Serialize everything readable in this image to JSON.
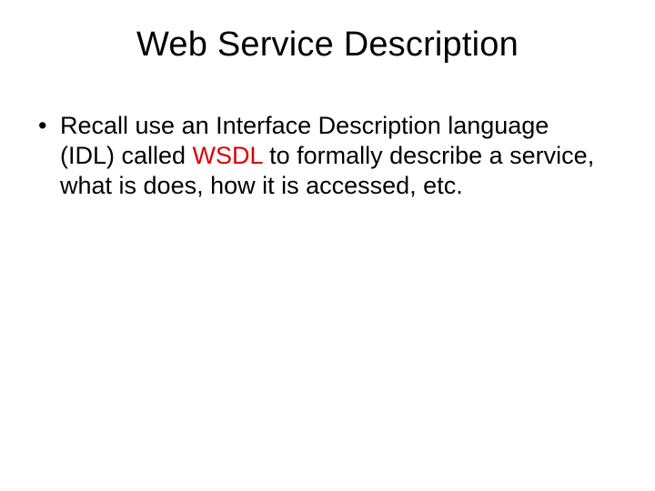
{
  "title": "Web Service Description",
  "bullet": {
    "pre": "Recall use an Interface Description language (IDL) called ",
    "highlight": "WSDL",
    "post": " to formally describe a service, what is does, how it is accessed, etc."
  }
}
